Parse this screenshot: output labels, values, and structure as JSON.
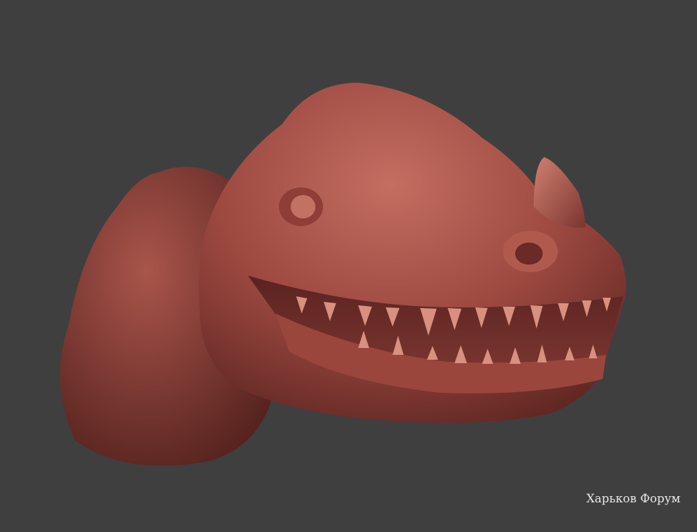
{
  "image": {
    "subject": "dinosaur-head-sculpt",
    "background_color": "#3f3f3f",
    "skin_color": "#a8534a"
  },
  "watermark": {
    "text": "Харьков Форум"
  }
}
